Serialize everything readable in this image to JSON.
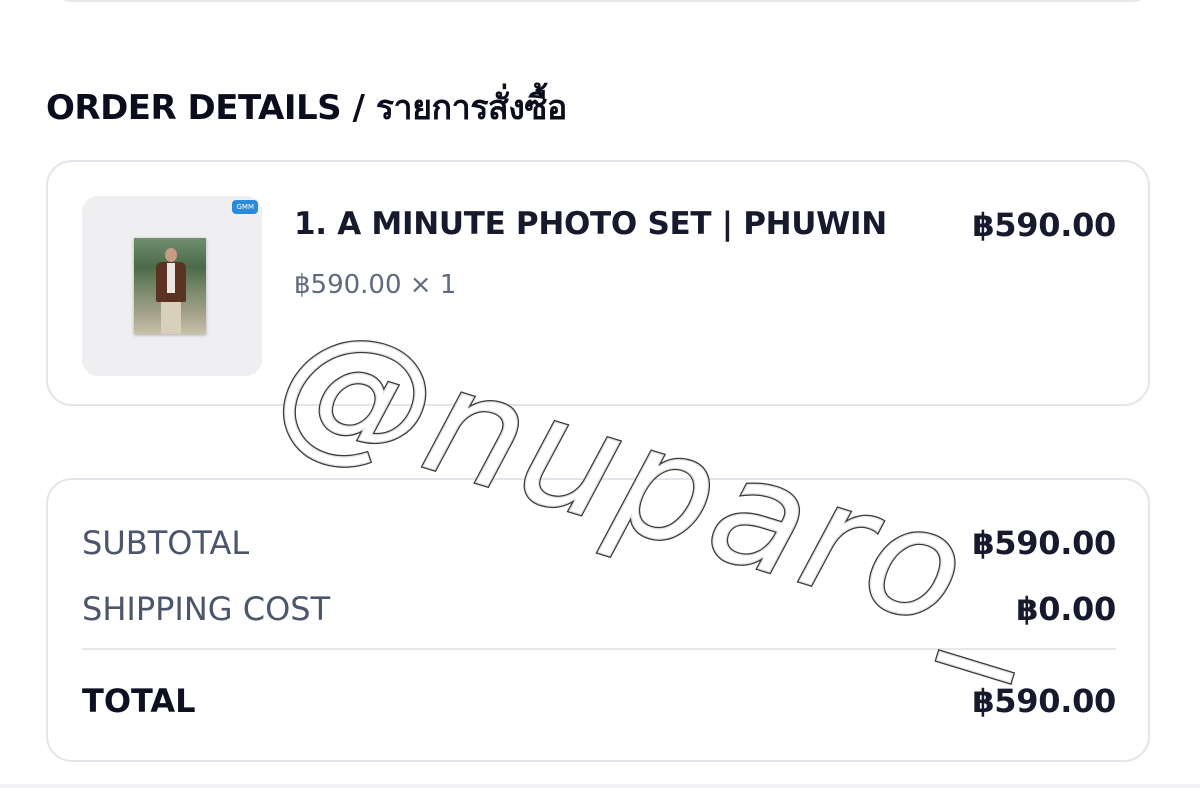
{
  "section": {
    "title": "ORDER DETAILS / รายการสั่งซื้อ"
  },
  "item": {
    "badge": "GMM",
    "name": "1. A MINUTE PHOTO SET | PHUWIN",
    "price": "฿590.00",
    "unit_qty": "฿590.00 × 1"
  },
  "summary": {
    "subtotal_label": "SUBTOTAL",
    "subtotal_value": "฿590.00",
    "shipping_label": "SHIPPING COST",
    "shipping_value": "฿0.00",
    "total_label": "TOTAL",
    "total_value": "฿590.00"
  },
  "watermark": {
    "text": "@nuparo_"
  },
  "colors": {
    "text_primary": "#161a2c",
    "text_secondary": "#4b556b",
    "border": "#e4e5ea",
    "thumb_bg": "#efeff1"
  }
}
